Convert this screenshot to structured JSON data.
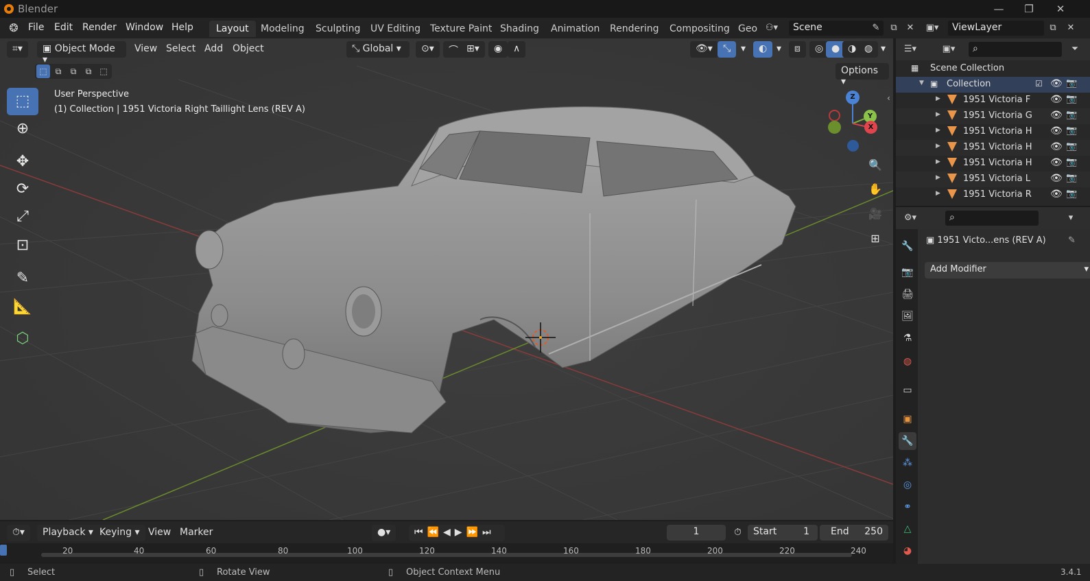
{
  "window": {
    "title": "Blender"
  },
  "menus": [
    "File",
    "Edit",
    "Render",
    "Window",
    "Help"
  ],
  "workspaces": [
    "Layout",
    "Modeling",
    "Sculpting",
    "UV Editing",
    "Texture Paint",
    "Shading",
    "Animation",
    "Rendering",
    "Compositing",
    "Geo"
  ],
  "scene": {
    "name": "Scene",
    "view_layer": "ViewLayer"
  },
  "viewport": {
    "mode": "Object Mode",
    "menus": [
      "View",
      "Select",
      "Add",
      "Object"
    ],
    "orientation": "Global",
    "options_label": "Options",
    "overlay_line1": "User Perspective",
    "overlay_line2": "(1) Collection | 1951 Victoria Right Taillight Lens (REV A)",
    "gizmo": {
      "z": "Z",
      "y": "Y",
      "x": "X"
    }
  },
  "timeline": {
    "menus": [
      "Playback",
      "Keying",
      "View",
      "Marker"
    ],
    "current_frame": "1",
    "start_label": "Start",
    "start": "1",
    "end_label": "End",
    "end": "250",
    "ticks": [
      "20",
      "40",
      "60",
      "80",
      "100",
      "120",
      "140",
      "160",
      "180",
      "200",
      "220",
      "240"
    ]
  },
  "statusbar": {
    "select": "Select",
    "rotate": "Rotate View",
    "context": "Object Context Menu",
    "version": "3.4.1"
  },
  "outliner": {
    "root": "Scene Collection",
    "collection": "Collection",
    "items": [
      "1951 Victoria F",
      "1951 Victoria G",
      "1951 Victoria H",
      "1951 Victoria H",
      "1951 Victoria H",
      "1951 Victoria L",
      "1951 Victoria R"
    ]
  },
  "properties": {
    "object_name": "1951 Victo...ens (REV A)",
    "add_modifier": "Add Modifier"
  },
  "colors": {
    "accent": "#4772b3",
    "mesh_icon": "#e9964a",
    "viewport_bg": "#393939"
  }
}
